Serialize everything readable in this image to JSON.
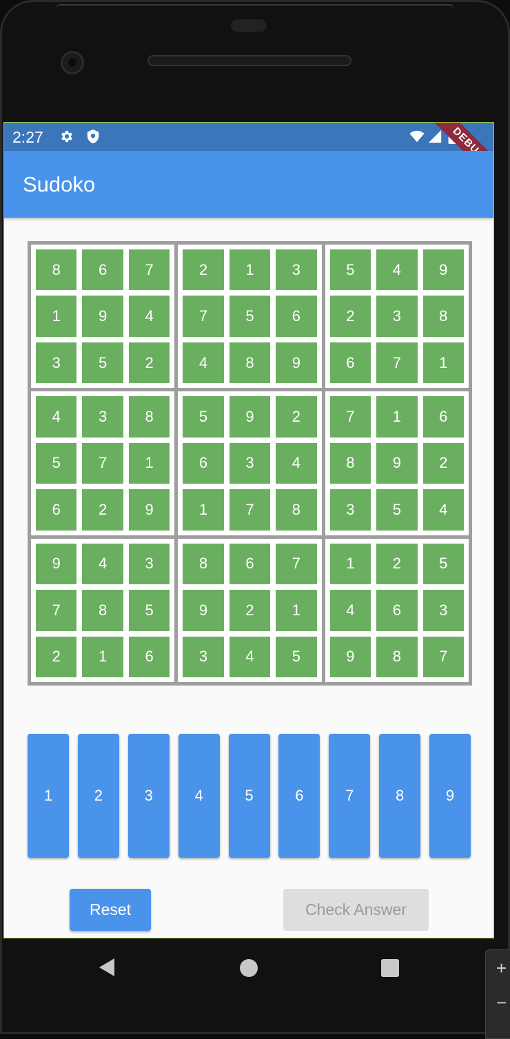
{
  "status_bar": {
    "time": "2:27",
    "icons": [
      "gear-icon",
      "shield-icon",
      "wifi-icon",
      "signal-icon",
      "battery-icon"
    ]
  },
  "app_bar": {
    "title": "Sudoko",
    "debug_label": "DEBUG"
  },
  "board": {
    "boxes": [
      [
        "8",
        "6",
        "7",
        "1",
        "9",
        "4",
        "3",
        "5",
        "2"
      ],
      [
        "2",
        "1",
        "3",
        "7",
        "5",
        "6",
        "4",
        "8",
        "9"
      ],
      [
        "5",
        "4",
        "9",
        "2",
        "3",
        "8",
        "6",
        "7",
        "1"
      ],
      [
        "4",
        "3",
        "8",
        "5",
        "7",
        "1",
        "6",
        "2",
        "9"
      ],
      [
        "5",
        "9",
        "2",
        "6",
        "3",
        "4",
        "1",
        "7",
        "8"
      ],
      [
        "7",
        "1",
        "6",
        "8",
        "9",
        "2",
        "3",
        "5",
        "4"
      ],
      [
        "9",
        "4",
        "3",
        "7",
        "8",
        "5",
        "2",
        "1",
        "6"
      ],
      [
        "8",
        "6",
        "7",
        "9",
        "2",
        "1",
        "3",
        "4",
        "5"
      ],
      [
        "1",
        "2",
        "5",
        "4",
        "6",
        "3",
        "9",
        "8",
        "7"
      ]
    ]
  },
  "number_buttons": [
    "1",
    "2",
    "3",
    "4",
    "5",
    "6",
    "7",
    "8",
    "9"
  ],
  "actions": {
    "reset_label": "Reset",
    "check_label": "Check Answer"
  },
  "nav": {
    "icons": [
      "back-icon",
      "home-icon",
      "recents-icon"
    ]
  },
  "emulator_panel": {
    "plus": "+",
    "minus": "−"
  },
  "colors": {
    "app_bar": "#4a93ea",
    "status_bar": "#3b76bb",
    "cell": "#6aaf5f",
    "grid_border": "#9e9e9e",
    "disabled_button": "#dedede",
    "debug_banner": "#8e2b3e"
  }
}
